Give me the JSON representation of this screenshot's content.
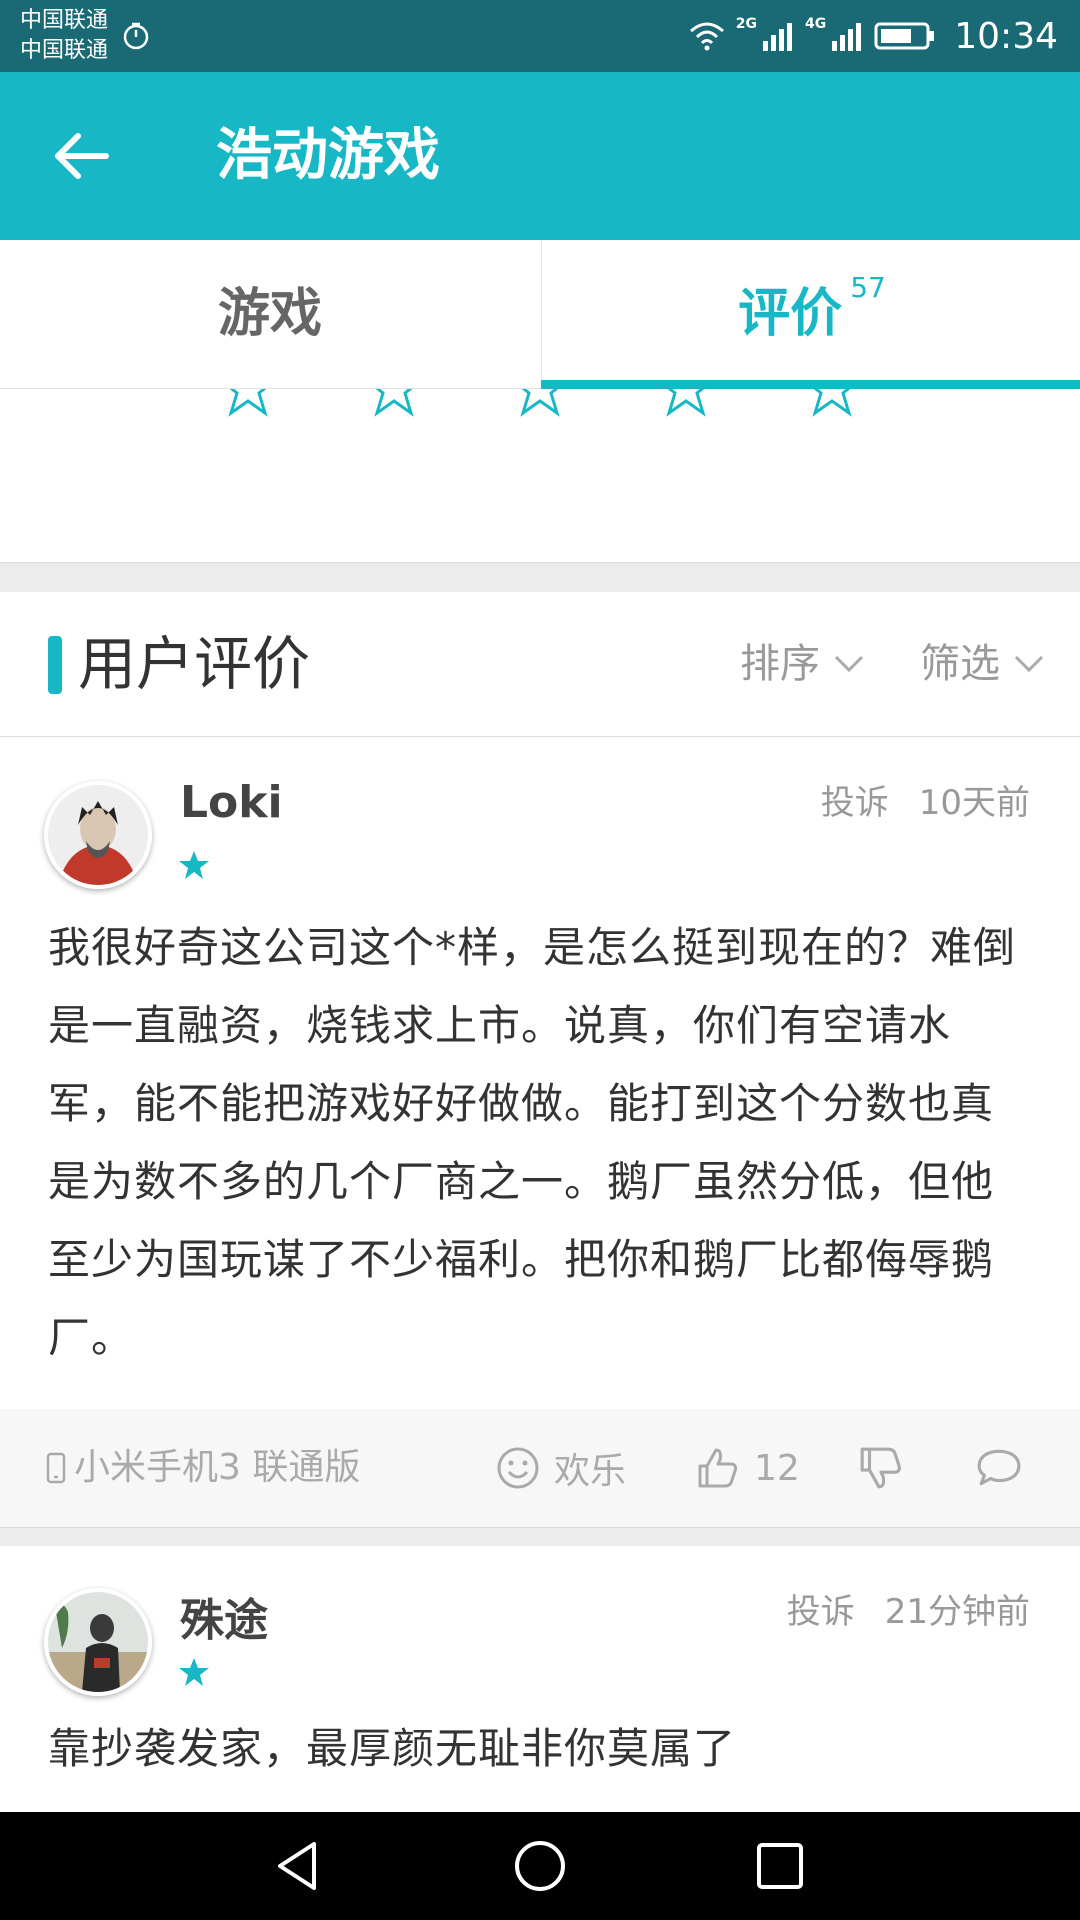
{
  "status_bar": {
    "carrier_1": "中国联通",
    "carrier_2": "中国联通",
    "net_1": "2G",
    "net_2": "4G",
    "time": "10:34"
  },
  "app_bar": {
    "title": "浩动游戏",
    "back_icon": "arrow-left-icon"
  },
  "tabs": [
    {
      "label": "游戏",
      "active": false
    },
    {
      "label": "评价",
      "count": "57",
      "active": true
    }
  ],
  "rating_stars_count": 5,
  "section": {
    "title": "用户评价",
    "sort_label": "排序",
    "filter_label": "筛选"
  },
  "reviews": [
    {
      "username": "Loki",
      "report": "投诉",
      "time": "10天前",
      "rating": 1,
      "body": "我很好奇这公司这个*样，是怎么挺到现在的？难倒是一直融资，烧钱求上市。说真，你们有空请水军，能不能把游戏好好做做。能打到这个分数也真是为数不多的几个厂商之一。鹅厂虽然分低，但他至少为国玩谋了不少福利。把你和鹅厂比都侮辱鹅厂。",
      "device": "小米手机3 联通版",
      "mood": "欢乐",
      "likes": "12"
    },
    {
      "username": "殊途",
      "report": "投诉",
      "time": "21分钟前",
      "rating": 1,
      "body": "靠抄袭发家，最厚颜无耻非你莫属了"
    }
  ],
  "colors": {
    "accent": "#17b7c6",
    "status_bar": "#1a6a75"
  }
}
